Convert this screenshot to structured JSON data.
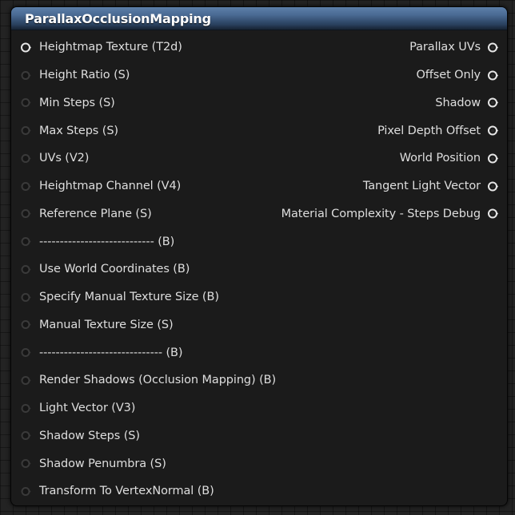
{
  "node": {
    "title": "ParallaxOcclusionMapping"
  },
  "inputs": [
    {
      "label": "Heightmap Texture (T2d)",
      "connected": true
    },
    {
      "label": "Height Ratio (S)",
      "connected": false
    },
    {
      "label": "Min Steps (S)",
      "connected": false
    },
    {
      "label": "Max Steps (S)",
      "connected": false
    },
    {
      "label": "UVs (V2)",
      "connected": false
    },
    {
      "label": "Heightmap Channel (V4)",
      "connected": false
    },
    {
      "label": "Reference Plane (S)",
      "connected": false
    },
    {
      "label": "---------------------------- (B)",
      "connected": false
    },
    {
      "label": "Use World Coordinates (B)",
      "connected": false
    },
    {
      "label": "Specify Manual Texture Size (B)",
      "connected": false
    },
    {
      "label": "Manual Texture Size (S)",
      "connected": false
    },
    {
      "label": "------------------------------ (B)",
      "connected": false
    },
    {
      "label": "Render Shadows (Occlusion Mapping) (B)",
      "connected": false
    },
    {
      "label": "Light Vector (V3)",
      "connected": false
    },
    {
      "label": "Shadow Steps (S)",
      "connected": false
    },
    {
      "label": "Shadow Penumbra (S)",
      "connected": false
    },
    {
      "label": "Transform To VertexNormal (B)",
      "connected": false
    }
  ],
  "outputs": [
    {
      "label": "Parallax UVs"
    },
    {
      "label": "Offset Only"
    },
    {
      "label": "Shadow"
    },
    {
      "label": "Pixel Depth Offset"
    },
    {
      "label": "World Position"
    },
    {
      "label": "Tangent Light Vector"
    },
    {
      "label": "Material Complexity - Steps Debug"
    }
  ],
  "colors": {
    "header_accent": "#4a6a93",
    "pin_connected": "#e6e6e6",
    "pin_unconnected": "#3a3a3a",
    "label_text": "#dedede"
  }
}
